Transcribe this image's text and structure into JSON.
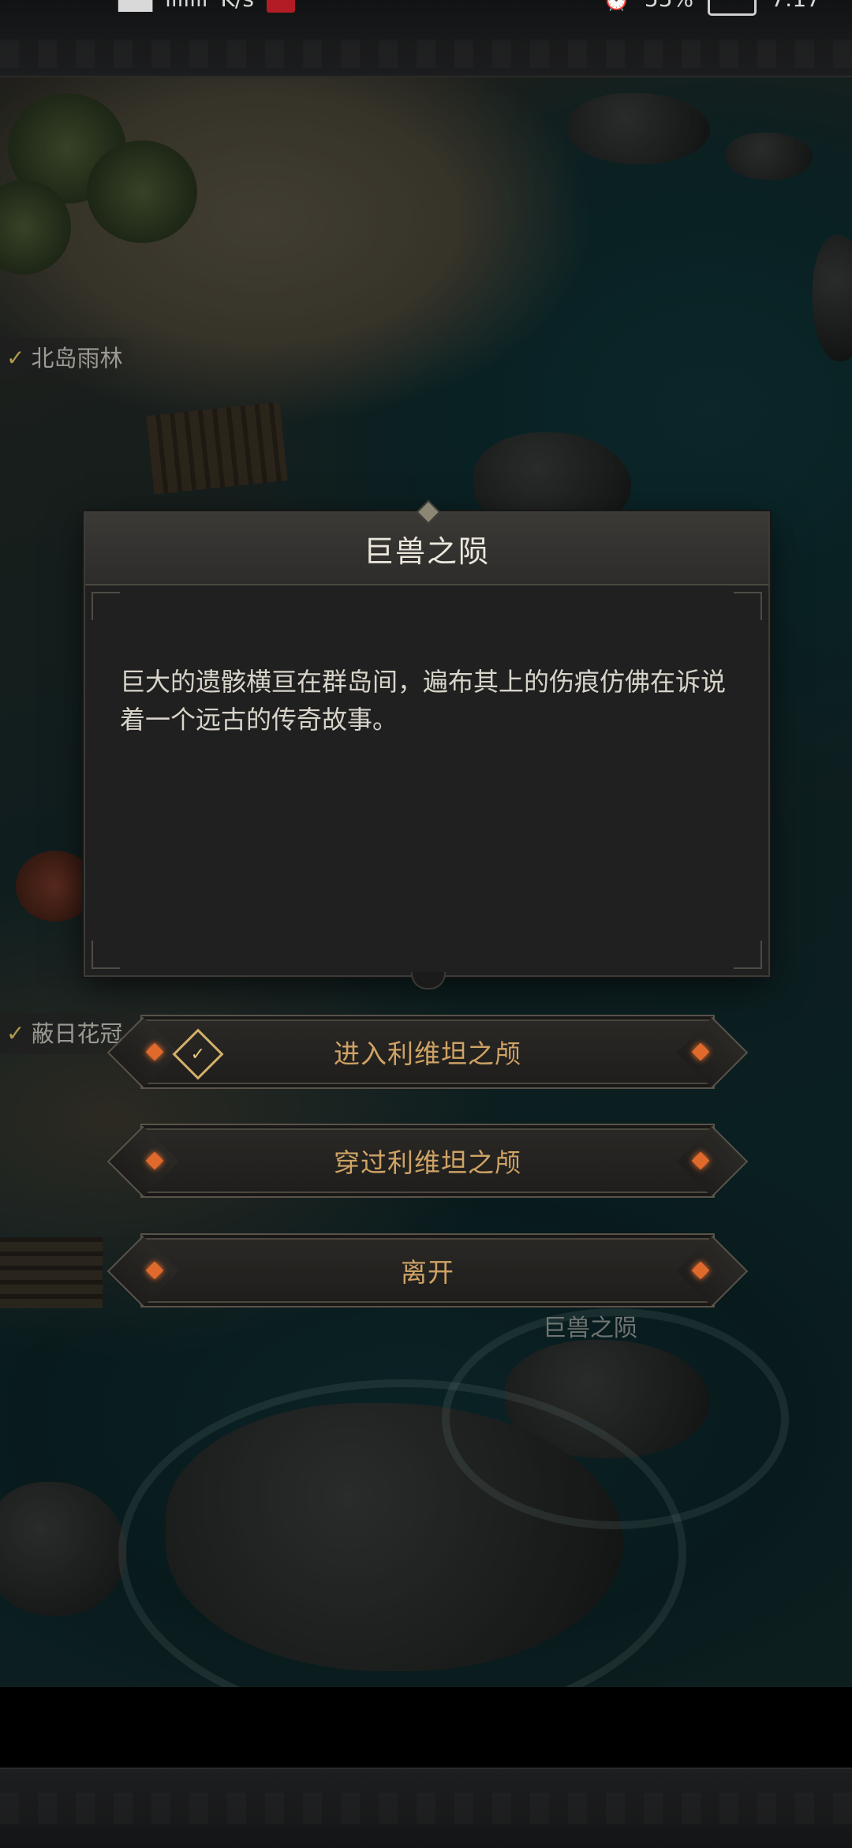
{
  "status_bar": {
    "network_speed_unit": "K/s",
    "battery_percent": "55%",
    "time": "7:17"
  },
  "map": {
    "labels": {
      "north_island": "北岛雨林",
      "sun_crown": "蔽日花冠",
      "beast_fall": "巨兽之陨"
    }
  },
  "dialog": {
    "title": "巨兽之陨",
    "body": "巨大的遗骸横亘在群岛间，遍布其上的伤痕仿佛在诉说着一个远古的传奇故事。"
  },
  "options": [
    {
      "label": "进入利维坦之颅",
      "icon": "quest-check-icon"
    },
    {
      "label": "穿过利维坦之颅"
    },
    {
      "label": "离开"
    }
  ],
  "colors": {
    "option_text": "#cfa365",
    "gem": "#e06a2c",
    "dialog_bg": "#202020"
  }
}
